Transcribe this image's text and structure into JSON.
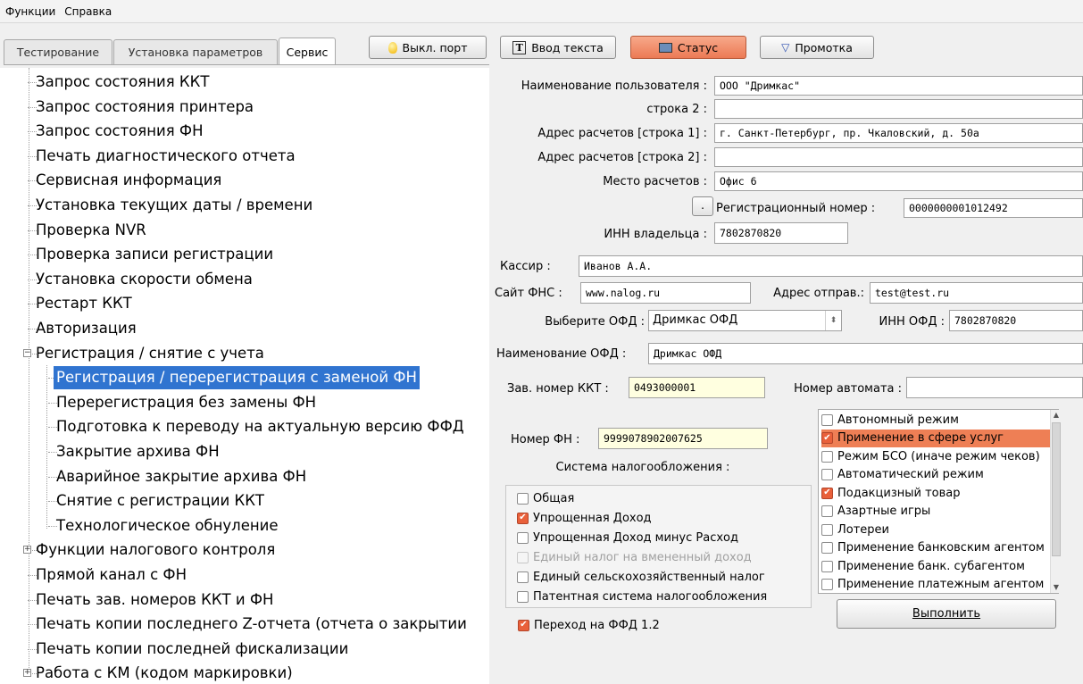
{
  "menu": [
    "Функции",
    "Справка"
  ],
  "tabs": [
    "Тестирование",
    "Установка параметров",
    "Сервис"
  ],
  "toolbar": {
    "port_label": "Выкл. порт",
    "text_label": "Ввод текста",
    "status_label": "Статус",
    "scroll_label": "Промотка"
  },
  "tree": {
    "items": [
      "Запрос состояния ККТ",
      "Запрос состояния принтера",
      "Запрос состояния ФН",
      "Печать диагностического отчета",
      "Сервисная информация",
      "Установка текущих даты / времени",
      "Проверка NVR",
      "Проверка записи регистрации",
      "Установка скорости обмена",
      "Рестарт ККТ",
      "Авторизация",
      "Регистрация / снятие с учета"
    ],
    "children": [
      "Регистрация / перерегистрация с заменой ФН",
      "Перерегистрация без замены ФН",
      "Подготовка к переводу на актуальную версию ФФД",
      "Закрытие архива ФН",
      "Аварийное закрытие архива ФН",
      "Снятие с регистрации ККТ",
      "Технологическое обнуление"
    ],
    "after": [
      "Функции налогового контроля",
      "Прямой канал с ФН",
      "Печать зав. номеров ККТ и ФН",
      "Печать копии последнего Z-отчета (отчета о закрытии",
      "Печать копии последней фискализации",
      "Работа с КМ (кодом маркировки)"
    ]
  },
  "form": {
    "user_name_label": "Наименование пользователя :",
    "user_name_value": "ООО \"Дримкас\"",
    "line2_label": "строка 2 :",
    "line2_value": "",
    "addr1_label": "Адрес расчетов [строка 1] :",
    "addr1_value": "г. Санкт-Петербург, пр. Чкаловский, д. 50а",
    "addr2_label": "Адрес расчетов [строка 2] :",
    "addr2_value": "",
    "place_label": "Место расчетов :",
    "place_value": "Офис 6",
    "dots_btn": ".",
    "reg_label": "Регистрационный номер :",
    "reg_value": "0000000001012492",
    "inn_owner_label": "ИНН владельца :",
    "inn_owner_value": "7802870820",
    "cashier_label": "Кассир :",
    "cashier_value": "Иванов А.А.",
    "fns_label": "Сайт ФНС :",
    "fns_value": "www.nalog.ru",
    "sender_label": "Адрес отправ.:",
    "sender_value": "test@test.ru",
    "ofd_select_label": "Выберите ОФД :",
    "ofd_select_value": "Дримкас ОФД",
    "inn_ofd_label": "ИНН ОФД :",
    "inn_ofd_value": "7802870820",
    "ofd_name_label": "Наименование ОФД :",
    "ofd_name_value": "Дримкас ОФД",
    "kkt_num_label": "Зав. номер ККТ :",
    "kkt_num_value": "0493000001",
    "automat_label": "Номер автомата :",
    "automat_value": "",
    "fn_label": "Номер ФН :",
    "fn_value": "9999078902007625",
    "tax_title": "Система  налогообложения :",
    "tax": [
      {
        "label": "Общая",
        "checked": false,
        "disabled": false
      },
      {
        "label": "Упрощенная Доход",
        "checked": true,
        "disabled": false
      },
      {
        "label": "Упрощенная Доход минус Расход",
        "checked": false,
        "disabled": false
      },
      {
        "label": "Единый налог на вмененный доход",
        "checked": false,
        "disabled": true
      },
      {
        "label": "Единый сельскохозяйственный налог",
        "checked": false,
        "disabled": false
      },
      {
        "label": "Патентная система налогообложения",
        "checked": false,
        "disabled": false
      }
    ],
    "modes": [
      {
        "label": "Автономный режим",
        "checked": false
      },
      {
        "label": "Применение в сфере услуг",
        "checked": true
      },
      {
        "label": "Режим БСО (иначе режим чеков)",
        "checked": false
      },
      {
        "label": "Автоматический режим",
        "checked": false
      },
      {
        "label": "Подакцизный товар",
        "checked": true
      },
      {
        "label": "Азартные игры",
        "checked": false
      },
      {
        "label": "Лотереи",
        "checked": false
      },
      {
        "label": "Применение банковским агентом",
        "checked": false
      },
      {
        "label": "Применение банк. субагентом",
        "checked": false
      },
      {
        "label": "Применение платежным агентом",
        "checked": false
      }
    ],
    "ffd_label": "Переход на ФФД 1.2",
    "ffd_checked": true,
    "execute_label": "Выполнить"
  }
}
